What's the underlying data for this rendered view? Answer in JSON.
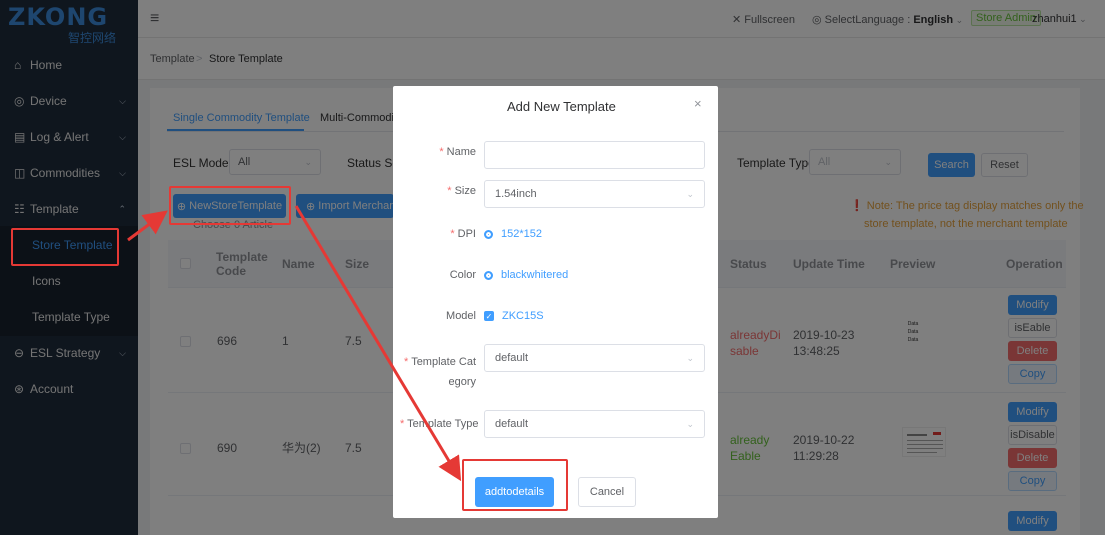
{
  "brand": {
    "logo_text": "ZKONG",
    "logo_sub": "智控网络"
  },
  "sidebar": {
    "items": [
      {
        "label": "Home",
        "icon": "home-icon",
        "glyph": "⌂"
      },
      {
        "label": "Device",
        "icon": "device-icon",
        "glyph": "◎"
      },
      {
        "label": "Log & Alert",
        "icon": "log-icon",
        "glyph": "▤"
      },
      {
        "label": "Commodities",
        "icon": "bag-icon",
        "glyph": "◫"
      },
      {
        "label": "Template",
        "icon": "template-icon",
        "glyph": "☷"
      },
      {
        "label": "Store Template"
      },
      {
        "label": "Icons"
      },
      {
        "label": "Template Type"
      },
      {
        "label": "ESL Strategy",
        "icon": "strategy-icon",
        "glyph": "⊖"
      },
      {
        "label": "Account",
        "icon": "account-icon",
        "glyph": "⊛"
      }
    ]
  },
  "topbar": {
    "fullscreen": "Fullscreen",
    "language_label": "SelectLanguage : ",
    "language_value": "English",
    "role_badge": "Store Admin",
    "username": "zhanhui1"
  },
  "breadcrumb": {
    "root": "Template",
    "sep": ">",
    "current": "Store Template"
  },
  "tabs": [
    "Single Commodity Template",
    "Multi-Commodity"
  ],
  "filters": {
    "esl_model_label": "ESL Model",
    "esl_model_value": "All",
    "status_label": "Status Sel",
    "template_type_label": "Template Type",
    "template_type_value": "All",
    "search": "Search",
    "reset": "Reset"
  },
  "actions": {
    "new_store_template": "NewStoreTemplate",
    "import_merchant": "Import Merchant",
    "choose_article": "Choose 0 Article"
  },
  "note": {
    "line1": "Note: The price tag display matches only the",
    "line2": "store template, not the merchant template"
  },
  "table": {
    "headers": {
      "code": "Template Code",
      "name": "Name",
      "size": "Size",
      "status": "Status",
      "update": "Update Time",
      "preview": "Preview",
      "operation": "Operation"
    },
    "rows": [
      {
        "code": "696",
        "name": "1",
        "size": "7.5",
        "status": "alreadyDisable",
        "status_color": "#f56c6c",
        "update": "2019-10-23 13:48:25",
        "btns": [
          "Modify",
          "isEable",
          "Delete",
          "Copy"
        ]
      },
      {
        "code": "690",
        "name": "华为(2)",
        "size": "7.5",
        "status": "already Eable",
        "status_color": "#67c23a",
        "update": "2019-10-22 11:29:28",
        "btns": [
          "Modify",
          "isDisable",
          "Delete",
          "Copy"
        ]
      },
      {
        "btns": [
          "Modify"
        ]
      }
    ],
    "preview_text": [
      "Data",
      "Data",
      "Data"
    ]
  },
  "modal": {
    "title": "Add New Template",
    "fields": {
      "name_label": "Name",
      "name_value": "",
      "size_label": "Size",
      "size_value": "1.54inch",
      "dpi_label": "DPI",
      "dpi_value": "152*152",
      "color_label": "Color",
      "color_value": "blackwhitered",
      "model_label": "Model",
      "model_value": "ZKC15S",
      "category_label": "Template Category",
      "category_value": "default",
      "type_label": "Template Type",
      "type_value": "default"
    },
    "ok": "addtodetails",
    "cancel": "Cancel"
  },
  "colors": {
    "primary": "#409eff",
    "sidebar_bg": "#1f2d3d",
    "annotation_red": "#e53935",
    "danger": "#f56c6c",
    "success": "#67c23a"
  }
}
